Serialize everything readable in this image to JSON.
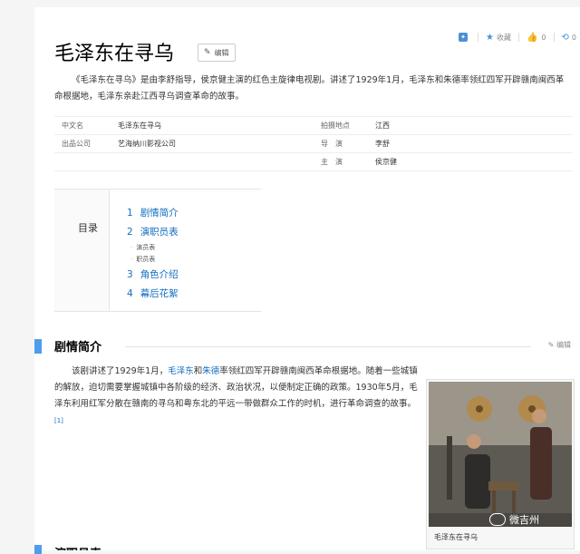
{
  "toolbar": {
    "share_icon": "share-icon",
    "favorite_label": "收藏",
    "like_count": "0",
    "share_count": "0"
  },
  "title": "毛泽东在寻乌",
  "edit_label": "编辑",
  "summary": "《毛泽东在寻乌》是由李舒指导，侯京健主演的红色主旋律电视剧。讲述了1929年1月，毛泽东和朱德率领红四军开辟赣南闽西革命根据地，毛泽东亲赴江西寻乌调查革命的故事。",
  "infobox": {
    "rows": [
      {
        "k1": "中文名",
        "v1": "毛泽东在寻乌",
        "k2": "拍摄地点",
        "v2": "江西"
      },
      {
        "k1": "出品公司",
        "v1": "艺海纳川影视公司",
        "k2": "导　演",
        "v2": "李舒"
      },
      {
        "k1": "",
        "v1": "",
        "k2": "主　演",
        "v2": "侯京健"
      }
    ]
  },
  "toc": {
    "title": "目录",
    "items": [
      {
        "num": "1",
        "label": "剧情简介"
      },
      {
        "num": "2",
        "label": "演职员表"
      },
      {
        "num": "3",
        "label": "角色介绍"
      },
      {
        "num": "4",
        "label": "幕后花絮"
      }
    ],
    "subitems": [
      "演员表",
      "职员表"
    ]
  },
  "section1": {
    "title": "剧情简介",
    "edit_label": "编辑",
    "p_a": "该剧讲述了1929年1月，",
    "link1": "毛泽东",
    "p_b": "和",
    "link2": "朱德",
    "p_c": "率领红四军开辟赣南闽西革命根据地。随着一些城镇的解放，迫切需要掌握城镇中各阶级的经济、政治状况，以便制定正确的政策。1930年5月，毛泽东利用红军分散在赣南的寻乌和粤东北的平远一带做群众工作的时机，进行革命调查的故事。",
    "ref": "[1]",
    "caption": "毛泽东在寻乌"
  },
  "watermark": "微吉州"
}
